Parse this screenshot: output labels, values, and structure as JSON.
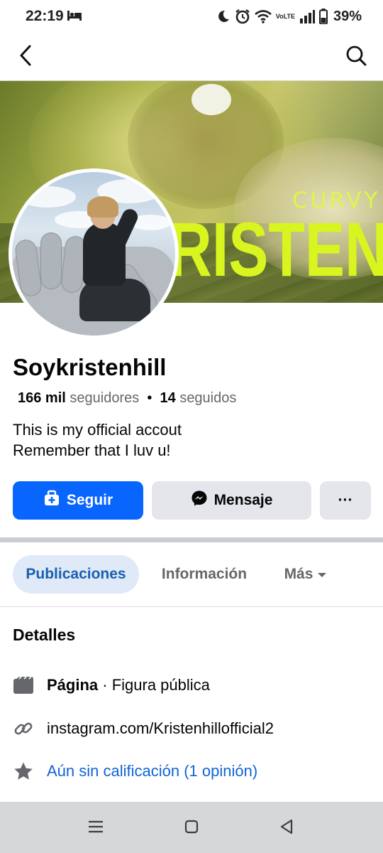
{
  "status_bar": {
    "time": "22:19",
    "battery_percent": "39%",
    "volte_line1": "Vo",
    "volte_line2": "LTE",
    "icons": [
      "sleep-icon",
      "moon-icon",
      "alarm-icon",
      "wifi-icon",
      "volte-icon",
      "signal-icon",
      "battery-icon"
    ]
  },
  "nav": {
    "icons": [
      "back-arrow-icon",
      "search-icon"
    ]
  },
  "cover": {
    "text_small": "CURVY",
    "text_big": "RISTEN I"
  },
  "profile": {
    "name": "Soykristenhill",
    "followers_count": "166 mil",
    "followers_label": "seguidores",
    "separator": "•",
    "following_count": "14",
    "following_label": "seguidos",
    "bio_line1": "This is my official accout",
    "bio_line2": "Remember that I luv u!"
  },
  "actions": {
    "follow_label": "Seguir",
    "message_label": "Mensaje",
    "more_label": "···",
    "colors": {
      "primary": "#0866ff",
      "secondary": "#e4e6eb"
    }
  },
  "tabs": [
    {
      "label": "Publicaciones",
      "active": true
    },
    {
      "label": "Información",
      "active": false
    },
    {
      "label": "Más",
      "active": false
    }
  ],
  "details": {
    "heading": "Detalles",
    "page_type_bold": "Página",
    "page_type_rest": " · Figura pública",
    "link": "instagram.com/Kristenhillofficial2",
    "rating": "Aún sin calificación (1 opinión)"
  },
  "system_nav": {
    "icons": [
      "recents-icon",
      "home-icon",
      "back-icon"
    ]
  }
}
